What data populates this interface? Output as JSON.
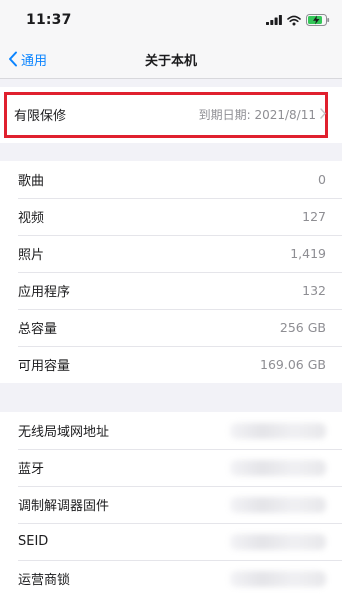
{
  "status_bar": {
    "time": "11:37"
  },
  "nav": {
    "back_label": "通用",
    "title": "关于本机"
  },
  "warranty": {
    "label": "有限保修",
    "value": "到期日期: 2021/8/11",
    "highlight_color": "#e0202e"
  },
  "media": [
    {
      "label": "歌曲",
      "value": "0"
    },
    {
      "label": "视频",
      "value": "127"
    },
    {
      "label": "照片",
      "value": "1,419"
    },
    {
      "label": "应用程序",
      "value": "132"
    },
    {
      "label": "总容量",
      "value": "256 GB"
    },
    {
      "label": "可用容量",
      "value": "169.06 GB"
    }
  ],
  "network": [
    {
      "label": "无线局域网地址"
    },
    {
      "label": "蓝牙"
    },
    {
      "label": "调制解调器固件"
    },
    {
      "label": "SEID"
    },
    {
      "label": "运营商锁"
    }
  ],
  "colors": {
    "accent": "#0a84ff",
    "battery": "#34c759"
  },
  "icons": [
    "signal-icon",
    "wifi-icon",
    "battery-charging-icon",
    "chevron-left-icon",
    "chevron-right-icon"
  ]
}
